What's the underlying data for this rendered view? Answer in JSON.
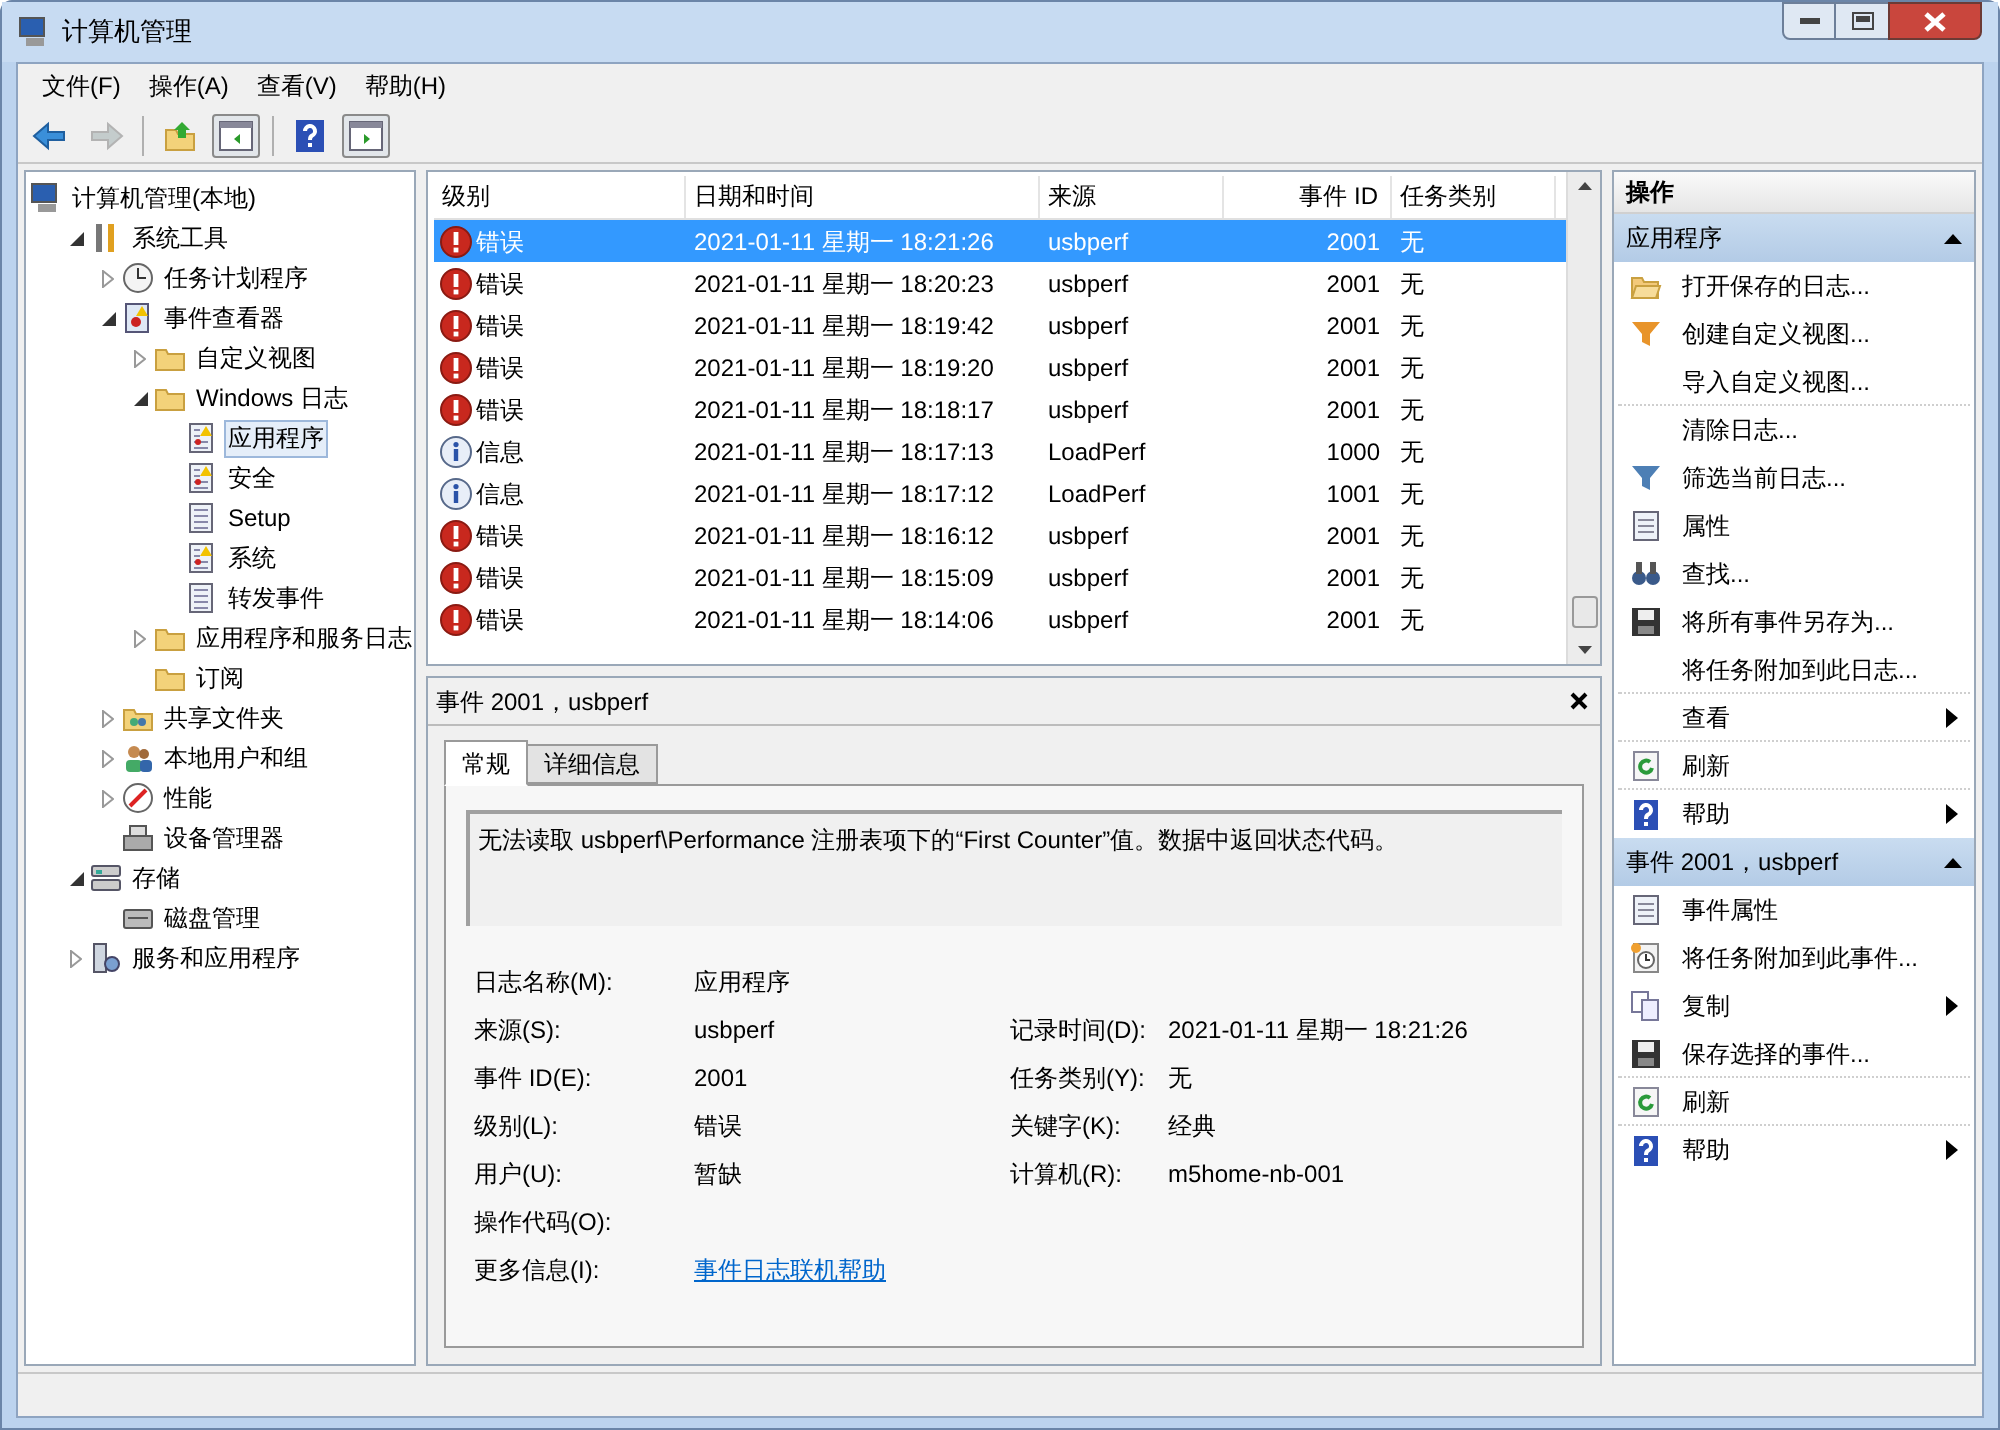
{
  "window": {
    "title": "计算机管理"
  },
  "menu": [
    "文件(F)",
    "操作(A)",
    "查看(V)",
    "帮助(H)"
  ],
  "toolbar": [
    {
      "kind": "back",
      "disabled": false
    },
    {
      "kind": "forward",
      "disabled": true
    },
    {
      "kind": "separator"
    },
    {
      "kind": "up",
      "disabled": false
    },
    {
      "kind": "pane-left",
      "disabled": false
    },
    {
      "kind": "separator"
    },
    {
      "kind": "help",
      "disabled": false
    },
    {
      "kind": "pane-right",
      "disabled": false
    }
  ],
  "tree": {
    "root": {
      "label": "计算机管理(本地)",
      "kind": "computer"
    },
    "items": [
      {
        "label": "系统工具",
        "kind": "tools",
        "expanded": true,
        "selected": false,
        "children": [
          {
            "label": "任务计划程序",
            "kind": "clock",
            "expanded": false,
            "selected": false
          },
          {
            "label": "事件查看器",
            "kind": "viewer",
            "expanded": true,
            "selected": false,
            "children": [
              {
                "label": "自定义视图",
                "kind": "folder",
                "expanded": false,
                "selected": false
              },
              {
                "label": "Windows 日志",
                "kind": "folder",
                "expanded": true,
                "selected": false,
                "children": [
                  {
                    "label": "应用程序",
                    "kind": "log-alert",
                    "selected": true
                  },
                  {
                    "label": "安全",
                    "kind": "log-alert",
                    "selected": false
                  },
                  {
                    "label": "Setup",
                    "kind": "log",
                    "selected": false
                  },
                  {
                    "label": "系统",
                    "kind": "log-alert",
                    "selected": false
                  },
                  {
                    "label": "转发事件",
                    "kind": "log",
                    "selected": false
                  }
                ]
              },
              {
                "label": "应用程序和服务日志",
                "kind": "folder",
                "expanded": false,
                "selected": false
              },
              {
                "label": "订阅",
                "kind": "folder",
                "selected": false
              }
            ]
          },
          {
            "label": "共享文件夹",
            "kind": "share",
            "expanded": false,
            "selected": false
          },
          {
            "label": "本地用户和组",
            "kind": "users",
            "expanded": false,
            "selected": false
          },
          {
            "label": "性能",
            "kind": "gauge",
            "expanded": false,
            "selected": false
          },
          {
            "label": "设备管理器",
            "kind": "device",
            "selected": false
          }
        ]
      },
      {
        "label": "存储",
        "kind": "storage",
        "expanded": true,
        "selected": false,
        "children": [
          {
            "label": "磁盘管理",
            "kind": "disk",
            "selected": false
          }
        ]
      },
      {
        "label": "服务和应用程序",
        "kind": "services",
        "expanded": false,
        "selected": false
      }
    ]
  },
  "events": {
    "columns": [
      "级别",
      "日期和时间",
      "来源",
      "事件 ID",
      "任务类别"
    ],
    "rows": [
      {
        "kind": "error",
        "level": "错误",
        "datetime": "2021-01-11 星期一 18:21:26",
        "source": "usbperf",
        "event_id": "2001",
        "category": "无",
        "selected": true
      },
      {
        "kind": "error",
        "level": "错误",
        "datetime": "2021-01-11 星期一 18:20:23",
        "source": "usbperf",
        "event_id": "2001",
        "category": "无",
        "selected": false
      },
      {
        "kind": "error",
        "level": "错误",
        "datetime": "2021-01-11 星期一 18:19:42",
        "source": "usbperf",
        "event_id": "2001",
        "category": "无",
        "selected": false
      },
      {
        "kind": "error",
        "level": "错误",
        "datetime": "2021-01-11 星期一 18:19:20",
        "source": "usbperf",
        "event_id": "2001",
        "category": "无",
        "selected": false
      },
      {
        "kind": "error",
        "level": "错误",
        "datetime": "2021-01-11 星期一 18:18:17",
        "source": "usbperf",
        "event_id": "2001",
        "category": "无",
        "selected": false
      },
      {
        "kind": "info",
        "level": "信息",
        "datetime": "2021-01-11 星期一 18:17:13",
        "source": "LoadPerf",
        "event_id": "1000",
        "category": "无",
        "selected": false
      },
      {
        "kind": "info",
        "level": "信息",
        "datetime": "2021-01-11 星期一 18:17:12",
        "source": "LoadPerf",
        "event_id": "1001",
        "category": "无",
        "selected": false
      },
      {
        "kind": "error",
        "level": "错误",
        "datetime": "2021-01-11 星期一 18:16:12",
        "source": "usbperf",
        "event_id": "2001",
        "category": "无",
        "selected": false
      },
      {
        "kind": "error",
        "level": "错误",
        "datetime": "2021-01-11 星期一 18:15:09",
        "source": "usbperf",
        "event_id": "2001",
        "category": "无",
        "selected": false
      },
      {
        "kind": "error",
        "level": "错误",
        "datetime": "2021-01-11 星期一 18:14:06",
        "source": "usbperf",
        "event_id": "2001",
        "category": "无",
        "selected": false
      }
    ]
  },
  "detail": {
    "title": "事件 2001，usbperf",
    "tabs": [
      {
        "label": "常规",
        "selected": true
      },
      {
        "label": "详细信息",
        "selected": false
      }
    ],
    "message": "无法读取 usbperf\\Performance 注册表项下的“First Counter”值。数据中返回状态代码。",
    "rows": [
      [
        {
          "label": "日志名称(M):",
          "value": "应用程序"
        }
      ],
      [
        {
          "label": "来源(S):",
          "value": "usbperf"
        },
        {
          "label": "记录时间(D):",
          "value": "2021-01-11 星期一 18:21:26"
        }
      ],
      [
        {
          "label": "事件 ID(E):",
          "value": "2001"
        },
        {
          "label": "任务类别(Y):",
          "value": "无"
        }
      ],
      [
        {
          "label": "级别(L):",
          "value": "错误"
        },
        {
          "label": "关键字(K):",
          "value": "经典"
        }
      ],
      [
        {
          "label": "用户(U):",
          "value": "暂缺"
        },
        {
          "label": "计算机(R):",
          "value": "m5home-nb-001"
        }
      ],
      [
        {
          "label": "操作代码(O):"
        }
      ],
      [
        {
          "label": "更多信息(I):",
          "value": "事件日志联机帮助",
          "kind": "link"
        }
      ]
    ]
  },
  "actions": {
    "title": "操作",
    "sections": [
      {
        "title": "应用程序",
        "expanded": true,
        "items": [
          {
            "label": "打开保存的日志...",
            "kind": "open",
            "submenu": false,
            "separator_after": false
          },
          {
            "label": "创建自定义视图...",
            "kind": "funnel-orange",
            "submenu": false,
            "separator_after": false
          },
          {
            "label": "导入自定义视图...",
            "kind": "none",
            "submenu": false,
            "separator_after": true
          },
          {
            "label": "清除日志...",
            "kind": "none",
            "submenu": false,
            "separator_after": false
          },
          {
            "label": "筛选当前日志...",
            "kind": "funnel-blue",
            "submenu": false,
            "separator_after": false
          },
          {
            "label": "属性",
            "kind": "properties",
            "submenu": false,
            "separator_after": false
          },
          {
            "label": "查找...",
            "kind": "binoculars",
            "submenu": false,
            "separator_after": false
          },
          {
            "label": "将所有事件另存为...",
            "kind": "save",
            "submenu": false,
            "separator_after": false
          },
          {
            "label": "将任务附加到此日志...",
            "kind": "none",
            "submenu": false,
            "separator_after": true
          },
          {
            "label": "查看",
            "kind": "none",
            "submenu": true,
            "separator_after": true
          },
          {
            "label": "刷新",
            "kind": "refresh",
            "submenu": false,
            "separator_after": true
          },
          {
            "label": "帮助",
            "kind": "help",
            "submenu": true,
            "separator_after": false
          }
        ]
      },
      {
        "title": "事件 2001，usbperf",
        "expanded": true,
        "items": [
          {
            "label": "事件属性",
            "kind": "properties",
            "submenu": false,
            "separator_after": false
          },
          {
            "label": "将任务附加到此事件...",
            "kind": "task",
            "submenu": false,
            "separator_after": false
          },
          {
            "label": "复制",
            "kind": "copy",
            "submenu": true,
            "separator_after": false
          },
          {
            "label": "保存选择的事件...",
            "kind": "save",
            "submenu": false,
            "separator_after": true
          },
          {
            "label": "刷新",
            "kind": "refresh",
            "submenu": false,
            "separator_after": true
          },
          {
            "label": "帮助",
            "kind": "help",
            "submenu": true,
            "separator_after": false
          }
        ]
      }
    ]
  }
}
